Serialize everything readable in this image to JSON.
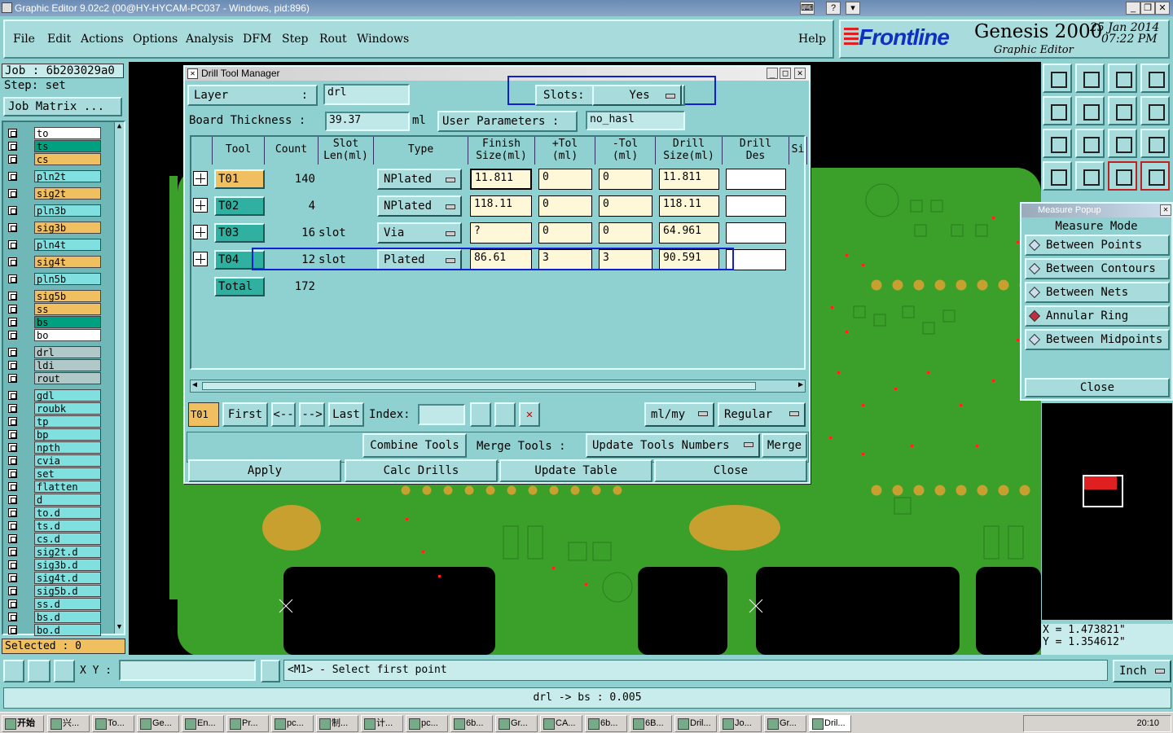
{
  "window": {
    "title": "Graphic Editor 9.02c2 (00@HY-HYCAM-PC037 - Windows, pid:896)"
  },
  "menu": [
    "File",
    "Edit",
    "Actions",
    "Options",
    "Analysis",
    "DFM",
    "Step",
    "Rout",
    "Windows"
  ],
  "help": "Help",
  "brand": {
    "logo": "Frontline",
    "product": "Genesis 2000",
    "subtitle": "Graphic Editor",
    "date": "25 Jan 2014",
    "time": "07:22 PM"
  },
  "job": {
    "job_label": "Job : 6b203029a0",
    "step_label": "Step: set",
    "matrix_btn": "Job Matrix ..."
  },
  "layers": [
    {
      "name": "to",
      "color": "#ffffff"
    },
    {
      "name": "ts",
      "color": "#00a080"
    },
    {
      "name": "cs",
      "color": "#f0c060"
    },
    {
      "name": "pln2t",
      "color": "#80e0e0"
    },
    {
      "name": "sig2t",
      "color": "#f0c060"
    },
    {
      "name": "pln3b",
      "color": "#80e0e0"
    },
    {
      "name": "sig3b",
      "color": "#f0c060"
    },
    {
      "name": "pln4t",
      "color": "#80e0e0"
    },
    {
      "name": "sig4t",
      "color": "#f0c060"
    },
    {
      "name": "pln5b",
      "color": "#80e0e0"
    },
    {
      "name": "sig5b",
      "color": "#f0c060"
    },
    {
      "name": "ss",
      "color": "#f0c060"
    },
    {
      "name": "bs",
      "color": "#00a080"
    },
    {
      "name": "bo",
      "color": "#ffffff"
    },
    {
      "name": "drl",
      "color": "#b0c8c8"
    },
    {
      "name": "ldi",
      "color": "#b0c8c8"
    },
    {
      "name": "rout",
      "color": "#b0c8c8"
    },
    {
      "name": "gdl",
      "color": "#80e0e0"
    },
    {
      "name": "roubk",
      "color": "#80e0e0"
    },
    {
      "name": "tp",
      "color": "#80e0e0"
    },
    {
      "name": "bp",
      "color": "#80e0e0"
    },
    {
      "name": "npth",
      "color": "#80e0e0"
    },
    {
      "name": "cvia",
      "color": "#80e0e0"
    },
    {
      "name": "set",
      "color": "#80e0e0"
    },
    {
      "name": "flatten",
      "color": "#80e0e0"
    },
    {
      "name": "d",
      "color": "#80e0e0"
    },
    {
      "name": "to.d",
      "color": "#80e0e0"
    },
    {
      "name": "ts.d",
      "color": "#80e0e0"
    },
    {
      "name": "cs.d",
      "color": "#80e0e0"
    },
    {
      "name": "sig2t.d",
      "color": "#80e0e0"
    },
    {
      "name": "sig3b.d",
      "color": "#80e0e0"
    },
    {
      "name": "sig4t.d",
      "color": "#80e0e0"
    },
    {
      "name": "sig5b.d",
      "color": "#80e0e0"
    },
    {
      "name": "ss.d",
      "color": "#80e0e0"
    },
    {
      "name": "bs.d",
      "color": "#80e0e0"
    },
    {
      "name": "bo.d",
      "color": "#80e0e0"
    }
  ],
  "selected": "Selected : 0",
  "dialog": {
    "title": "Drill Tool Manager",
    "layer_label": "Layer",
    "layer_value": "drl",
    "slots_label": "Slots:",
    "slots_value": "Yes",
    "thickness_label": "Board Thickness :",
    "thickness_value": "39.37",
    "thickness_unit": "ml",
    "user_params_label": "User Parameters :",
    "user_params_value": "no_hasl",
    "headers": [
      "Tool",
      "Count",
      "Slot\nLen(ml)",
      "Type",
      "Finish\nSize(ml)",
      "+Tol\n(ml)",
      "-Tol\n(ml)",
      "Drill\nSize(ml)",
      "Drill\nDes",
      "Si"
    ],
    "rows": [
      {
        "tool": "T01",
        "count": "140",
        "slot": "",
        "type": "NPlated",
        "finish": "11.811",
        "ptol": "0",
        "mtol": "0",
        "drill": "11.811",
        "des": ""
      },
      {
        "tool": "T02",
        "count": "4",
        "slot": "",
        "type": "NPlated",
        "finish": "118.11",
        "ptol": "0",
        "mtol": "0",
        "drill": "118.11",
        "des": ""
      },
      {
        "tool": "T03",
        "count": "16",
        "slot": "slot",
        "type": "Via",
        "finish": "?",
        "ptol": "0",
        "mtol": "0",
        "drill": "64.961",
        "des": ""
      },
      {
        "tool": "T04",
        "count": "12",
        "slot": "slot",
        "type": "Plated",
        "finish": "86.61",
        "ptol": "3",
        "mtol": "3",
        "drill": "90.591",
        "des": ""
      }
    ],
    "total_label": "Total",
    "total_value": "172",
    "current_tool": "T01",
    "nav": {
      "first": "First",
      "prev": "<--",
      "next": "-->",
      "last": "Last",
      "index": "Index:"
    },
    "units": "ml/my",
    "mode": "Regular",
    "combine": "Combine Tools",
    "merge_label": "Merge Tools :",
    "update_nums": "Update Tools Numbers",
    "merge": "Merge",
    "apply": "Apply",
    "calc": "Calc Drills",
    "update_table": "Update Table",
    "close": "Close"
  },
  "measure": {
    "title": "Measure Popup",
    "mode_label": "Measure Mode",
    "options": [
      "Between Points",
      "Between Contours",
      "Between Nets",
      "Annular Ring",
      "Between Midpoints"
    ],
    "selected": "Annular Ring",
    "close": "Close"
  },
  "coords": {
    "x": "X = 1.473821\"",
    "y": "Y = 1.354612\""
  },
  "status": {
    "xy_label": "X Y :",
    "xy_value": "",
    "message": "<M1> - Select first point",
    "unit": "Inch",
    "bottom": "drl -> bs : 0.005"
  },
  "taskbar": {
    "start": "开始",
    "items": [
      "兴...",
      "To...",
      "Ge...",
      "En...",
      "Pr...",
      "pc...",
      "制...",
      "计...",
      "pc...",
      "6b...",
      "Gr...",
      "CA...",
      "6b...",
      "6B...",
      "Dril...",
      "Jo...",
      "Gr...",
      "Dril..."
    ],
    "clock": "20:10"
  },
  "colors": {
    "app_bg": "#8fd0d0",
    "board_green": "#3aa02a",
    "pad_gold": "#c8a030",
    "highlight_blue": "#1020d0"
  }
}
